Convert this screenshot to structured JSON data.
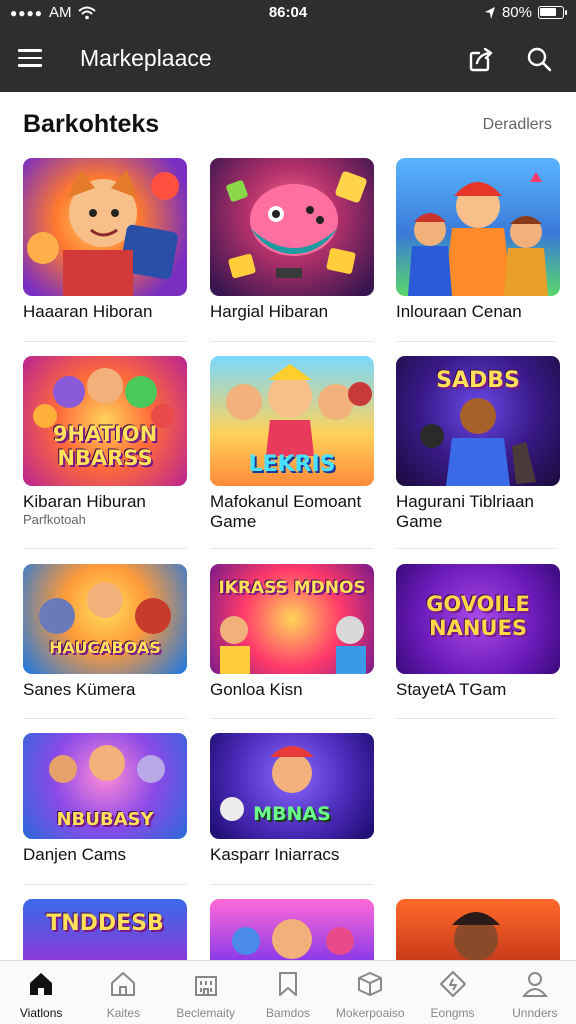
{
  "status_bar": {
    "carrier": "AM",
    "time": "86:04",
    "battery": "80%"
  },
  "app_bar": {
    "title": "Markeplaace"
  },
  "section": {
    "title": "Barkohteks",
    "link": "Deradlers"
  },
  "cards": [
    {
      "title": "Haaaran Hiboran",
      "subtitle": "",
      "art_text": ""
    },
    {
      "title": "Hargial Hibaran",
      "subtitle": "",
      "art_text": ""
    },
    {
      "title": "Inlouraan Cenan",
      "subtitle": "",
      "art_text": ""
    },
    {
      "title": "Kibaran Hiburan",
      "subtitle": "Parfkotoah",
      "art_text": "9HATION NBARSS"
    },
    {
      "title": "Mafokanul Eomoant Game",
      "subtitle": "",
      "art_text": "LEKRIS"
    },
    {
      "title": "Hagurani Tiblriaan Game",
      "subtitle": "",
      "art_text": "SADBS"
    },
    {
      "title": "Sanes Kümera",
      "subtitle": "",
      "art_text": "HAUCABOAS"
    },
    {
      "title": "Gonloa Kisn",
      "subtitle": "",
      "art_text": "IKRASS MDNOS"
    },
    {
      "title": "StayetA TGam",
      "subtitle": "",
      "art_text": "GOVOILE NANUES"
    },
    {
      "title": "Danjen Cams",
      "subtitle": "",
      "art_text": "NBUBASY"
    },
    {
      "title": "Kasparr Iniarracs",
      "subtitle": "",
      "art_text": "MBNAS"
    },
    {
      "title": "",
      "subtitle": "",
      "art_text": "TNDDESB"
    },
    {
      "title": "",
      "subtitle": "",
      "art_text": ""
    },
    {
      "title": "",
      "subtitle": "",
      "art_text": ""
    }
  ],
  "nav": [
    {
      "label": "Viatlons",
      "icon": "home-icon",
      "active": true
    },
    {
      "label": "Kaites",
      "icon": "house-outline-icon",
      "active": false
    },
    {
      "label": "Beclemaity",
      "icon": "building-icon",
      "active": false
    },
    {
      "label": "Bamdos",
      "icon": "bookmark-icon",
      "active": false
    },
    {
      "label": "Mokerpoaiso",
      "icon": "box-icon",
      "active": false
    },
    {
      "label": "Eongms",
      "icon": "tag-icon",
      "active": false
    },
    {
      "label": "Unnders",
      "icon": "person-icon",
      "active": false
    }
  ],
  "colors": {
    "bar": "#2e2e2e",
    "accent_text": "#ffe25a"
  }
}
